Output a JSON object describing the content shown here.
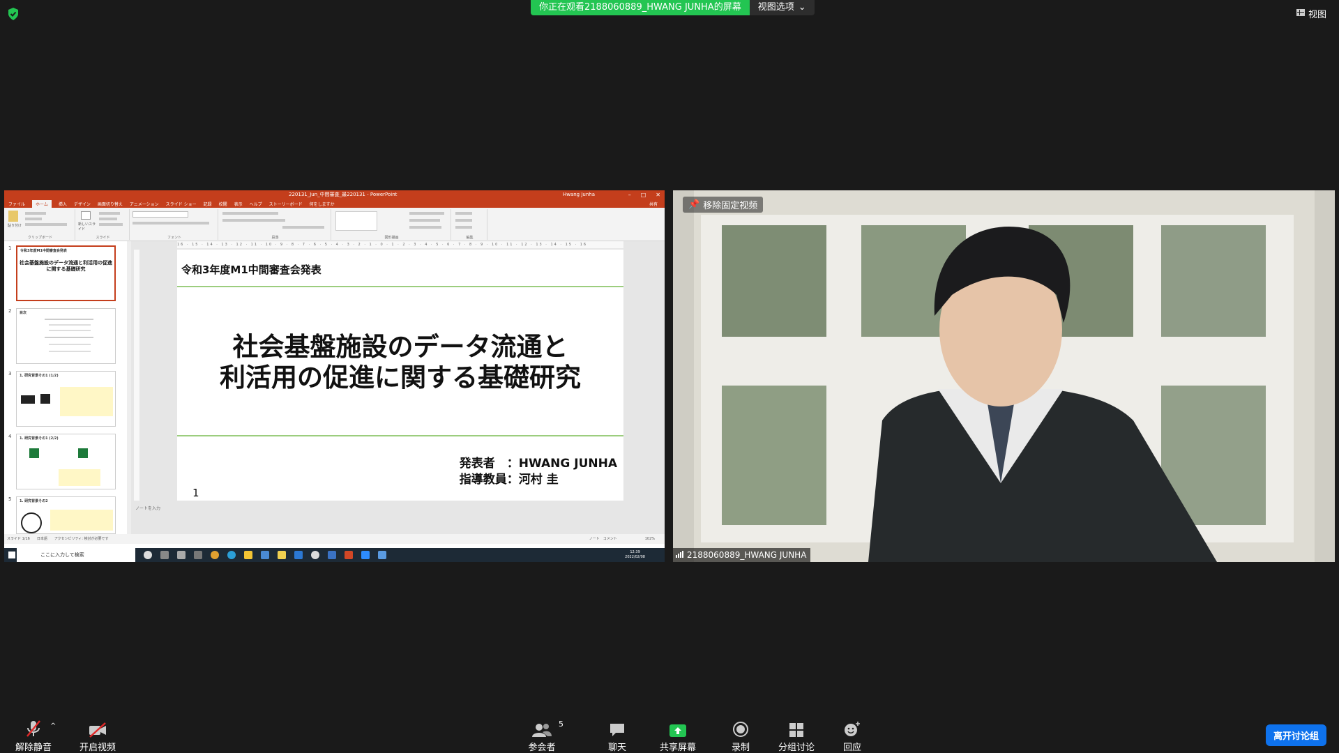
{
  "banner": {
    "sharing_text": "你正在观看2188060889_HWANG JUNHA的屏幕",
    "view_options": "视图选项"
  },
  "top_right": {
    "view_label": "视图"
  },
  "powerpoint": {
    "filename": "220131_Jun_中間審査_最220131 - PowerPoint",
    "user": "Hwang Junha",
    "tabs": [
      "ファイル",
      "ホーム",
      "挿入",
      "デザイン",
      "画面切り替え",
      "アニメーション",
      "スライド ショー",
      "記録",
      "校閲",
      "表示",
      "ヘルプ",
      "ストーリーボード",
      "何をしますか"
    ],
    "share": "共有",
    "ribbon_groups": [
      "クリップボード",
      "スライド",
      "フォント",
      "段落",
      "図形描画",
      "編集"
    ],
    "paste": "貼り付け",
    "new_slide": "新しいスライド",
    "thumbnails": [
      {
        "num": "1",
        "title": "令和3年度M1中間審査会発表",
        "body": "社会基盤施設のデータ流通と利活用の促進に関する基礎研究"
      },
      {
        "num": "2",
        "title": "目次"
      },
      {
        "num": "3",
        "title": "1. 研究背景その1 (1/2)"
      },
      {
        "num": "4",
        "title": "1. 研究背景その1 (2/2)"
      },
      {
        "num": "5",
        "title": "1. 研究背景その2"
      }
    ],
    "ruler": "16 · 15 · 14 · 13 · 12 · 11 · 10 · 9 · 8 · 7 · 6 · 5 · 4 · 3 · 2 · 1 · 0 · 1 · 2 · 3 · 4 · 5 · 6 · 7 · 8 · 9 · 10 · 11 · 12 · 13 · 14 · 15 · 16",
    "slide": {
      "header": "令和3年度M1中間審査会発表",
      "title_line1": "社会基盤施設のデータ流通と",
      "title_line2": "利活用の促進に関する基礎研究",
      "presenter": "発表者　：HWANG JUNHA",
      "advisor": "指導教員：河村 圭",
      "page": "1"
    },
    "notes_placeholder": "ノートを入力",
    "status_left": "スライド 1/16　　日本語　　アクセシビリティ: 検討が必要です",
    "status_right": "ノート　コメント　　　　　　　　102%",
    "taskbar_search": "ここに入力して検索",
    "clock_time": "12:39",
    "clock_date": "2022/02/08"
  },
  "camera": {
    "unpin_label": "移除固定视频",
    "participant_name": "2188060889_HWANG JUNHA"
  },
  "toolbar": {
    "unmute": "解除静音",
    "start_video": "开启视频",
    "participants": "参会者",
    "participant_count": "5",
    "chat": "聊天",
    "share_screen": "共享屏幕",
    "record": "录制",
    "breakout": "分组讨论",
    "reactions": "回应",
    "leave": "离开讨论组"
  },
  "colors": {
    "green_banner": "#23c552",
    "ppt_red": "#c43e1c",
    "leave_blue": "#0e72ed",
    "share_green": "#23c552"
  }
}
